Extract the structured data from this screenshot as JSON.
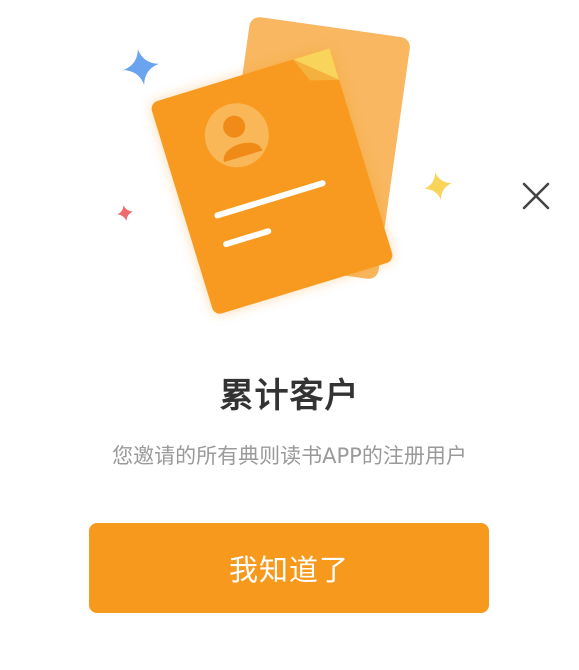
{
  "dialog": {
    "title": "累计客户",
    "description": "您邀请的所有典则读书APP的注册用户",
    "confirm_label": "我知道了",
    "close_icon": "close-icon",
    "illustration_icon": "customer-cards-illustration"
  },
  "colors": {
    "accent": "#f7991c",
    "card_back": "#f8b760",
    "title": "#333333",
    "subtitle": "#9a9a9a",
    "sparkle_blue": "#6aa3ee",
    "sparkle_yellow": "#f8d45a",
    "sparkle_red": "#ee6a6e"
  }
}
